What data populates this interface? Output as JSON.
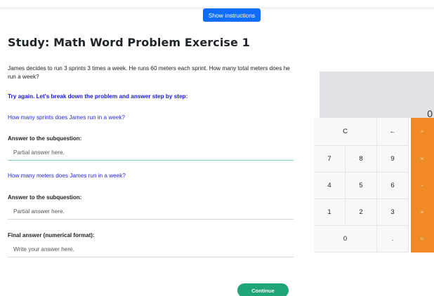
{
  "header": {
    "instructions_button": "Show instructions"
  },
  "title": "Study: Math Word Problem Exercise 1",
  "problem": "James decides to run 3 sprints 3 times a week. He runs 60 meters each sprint. How many total meters does he run a week?",
  "try_again": "Try again. Let's break down the problem and answer step by step:",
  "subquestions": [
    {
      "question": "How many sprints does James run in a week?",
      "label": "Answer to the subquestion:",
      "placeholder": "Partial answer here."
    },
    {
      "question": "How many meters does James run in a week?",
      "label": "Answer to the subquestion:",
      "placeholder": "Partial answer here."
    }
  ],
  "final": {
    "label": "Final answer (numerical format):",
    "placeholder": "Write your answer here."
  },
  "continue_button": "Continue",
  "calculator": {
    "display": "0",
    "keys": {
      "clear": "C",
      "backspace": "←",
      "divide": "÷",
      "seven": "7",
      "eight": "8",
      "nine": "9",
      "multiply": "×",
      "four": "4",
      "five": "5",
      "six": "6",
      "subtract": "-",
      "one": "1",
      "two": "2",
      "three": "3",
      "add": "+",
      "zero": "0",
      "decimal": ".",
      "equals": "="
    }
  },
  "colors": {
    "primary_button": "#0d6efd",
    "continue_button": "#20a47a",
    "operator_key": "#f08a24",
    "question_text": "#2828e6"
  }
}
